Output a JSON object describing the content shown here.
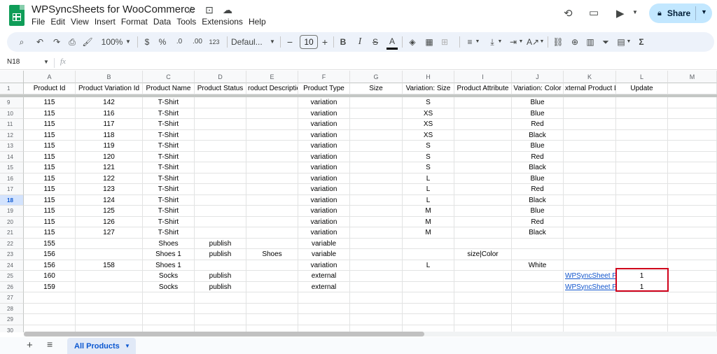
{
  "app": {
    "title": "WPSyncSheets for WooCommerce",
    "title_icons": [
      "☆",
      "⊡",
      "☁"
    ],
    "menu": [
      "File",
      "Edit",
      "View",
      "Insert",
      "Format",
      "Data",
      "Tools",
      "Extensions",
      "Help"
    ],
    "share_label": "Share",
    "brand_color": "#0f9d58"
  },
  "toolbar": {
    "zoom": "100%",
    "currency": "$",
    "percent": "%",
    "dec_decrease": ".0",
    "dec_increase": ".00",
    "number_format": "123",
    "font": "Defaul...",
    "font_size": "10",
    "bold": "B",
    "italic": "I",
    "strike": "S",
    "text_color": "A",
    "sigma": "Σ"
  },
  "formula_bar": {
    "name_box": "N18",
    "fx": "fx"
  },
  "grid": {
    "columns": [
      "A",
      "B",
      "C",
      "D",
      "E",
      "F",
      "G",
      "H",
      "I",
      "J",
      "K",
      "L",
      "M"
    ],
    "header_row_number": "1",
    "headers": [
      "Product Id",
      "Product Variation Id",
      "Product Name",
      "Product Status",
      "roduct Descriptio",
      "Product Type",
      "Size",
      "Variation: Size",
      "Product Attribute",
      "Variation: Color",
      "xternal Product Li",
      "Update",
      ""
    ],
    "active_row": "18",
    "rows": [
      {
        "n": "9",
        "cells": [
          "115",
          "142",
          "T-Shirt",
          "",
          "",
          "variation",
          "",
          "S",
          "",
          "Blue",
          "",
          "",
          ""
        ]
      },
      {
        "n": "10",
        "cells": [
          "115",
          "116",
          "T-Shirt",
          "",
          "",
          "variation",
          "",
          "XS",
          "",
          "Blue",
          "",
          "",
          ""
        ]
      },
      {
        "n": "11",
        "cells": [
          "115",
          "117",
          "T-Shirt",
          "",
          "",
          "variation",
          "",
          "XS",
          "",
          "Red",
          "",
          "",
          ""
        ]
      },
      {
        "n": "12",
        "cells": [
          "115",
          "118",
          "T-Shirt",
          "",
          "",
          "variation",
          "",
          "XS",
          "",
          "Black",
          "",
          "",
          ""
        ]
      },
      {
        "n": "13",
        "cells": [
          "115",
          "119",
          "T-Shirt",
          "",
          "",
          "variation",
          "",
          "S",
          "",
          "Blue",
          "",
          "",
          ""
        ]
      },
      {
        "n": "14",
        "cells": [
          "115",
          "120",
          "T-Shirt",
          "",
          "",
          "variation",
          "",
          "S",
          "",
          "Red",
          "",
          "",
          ""
        ]
      },
      {
        "n": "15",
        "cells": [
          "115",
          "121",
          "T-Shirt",
          "",
          "",
          "variation",
          "",
          "S",
          "",
          "Black",
          "",
          "",
          ""
        ]
      },
      {
        "n": "16",
        "cells": [
          "115",
          "122",
          "T-Shirt",
          "",
          "",
          "variation",
          "",
          "L",
          "",
          "Blue",
          "",
          "",
          ""
        ]
      },
      {
        "n": "17",
        "cells": [
          "115",
          "123",
          "T-Shirt",
          "",
          "",
          "variation",
          "",
          "L",
          "",
          "Red",
          "",
          "",
          ""
        ]
      },
      {
        "n": "18",
        "cells": [
          "115",
          "124",
          "T-Shirt",
          "",
          "",
          "variation",
          "",
          "L",
          "",
          "Black",
          "",
          "",
          ""
        ]
      },
      {
        "n": "19",
        "cells": [
          "115",
          "125",
          "T-Shirt",
          "",
          "",
          "variation",
          "",
          "M",
          "",
          "Blue",
          "",
          "",
          ""
        ]
      },
      {
        "n": "20",
        "cells": [
          "115",
          "126",
          "T-Shirt",
          "",
          "",
          "variation",
          "",
          "M",
          "",
          "Red",
          "",
          "",
          ""
        ]
      },
      {
        "n": "21",
        "cells": [
          "115",
          "127",
          "T-Shirt",
          "",
          "",
          "variation",
          "",
          "M",
          "",
          "Black",
          "",
          "",
          ""
        ]
      },
      {
        "n": "22",
        "cells": [
          "155",
          "",
          "Shoes",
          "publish",
          "",
          "variable",
          "",
          "",
          "",
          "",
          "",
          "",
          ""
        ]
      },
      {
        "n": "23",
        "cells": [
          "156",
          "",
          "Shoes 1",
          "publish",
          "Shoes",
          "variable",
          "",
          "",
          "size|Color",
          "",
          "",
          "",
          ""
        ]
      },
      {
        "n": "24",
        "cells": [
          "156",
          "158",
          "Shoes 1",
          "",
          "",
          "variation",
          "",
          "L",
          "",
          "White",
          "",
          "",
          ""
        ]
      },
      {
        "n": "25",
        "cells": [
          "160",
          "",
          "Socks",
          "publish",
          "",
          "external",
          "",
          "",
          "",
          "",
          "WPSyncSheet Plug",
          "1",
          ""
        ]
      },
      {
        "n": "26",
        "cells": [
          "159",
          "",
          "Socks",
          "publish",
          "",
          "external",
          "",
          "",
          "",
          "",
          "WPSyncSheet Plug",
          "1",
          ""
        ]
      },
      {
        "n": "27",
        "cells": [
          "",
          "",
          "",
          "",
          "",
          "",
          "",
          "",
          "",
          "",
          "",
          "",
          ""
        ]
      },
      {
        "n": "28",
        "cells": [
          "",
          "",
          "",
          "",
          "",
          "",
          "",
          "",
          "",
          "",
          "",
          "",
          ""
        ]
      },
      {
        "n": "29",
        "cells": [
          "",
          "",
          "",
          "",
          "",
          "",
          "",
          "",
          "",
          "",
          "",
          "",
          ""
        ]
      },
      {
        "n": "30",
        "cells": [
          "",
          "",
          "",
          "",
          "",
          "",
          "",
          "",
          "",
          "",
          "",
          "",
          ""
        ]
      }
    ],
    "link_color": "#1155cc",
    "highlight_color": "#d0021b"
  },
  "sheets": {
    "active_tab": "All Products"
  }
}
